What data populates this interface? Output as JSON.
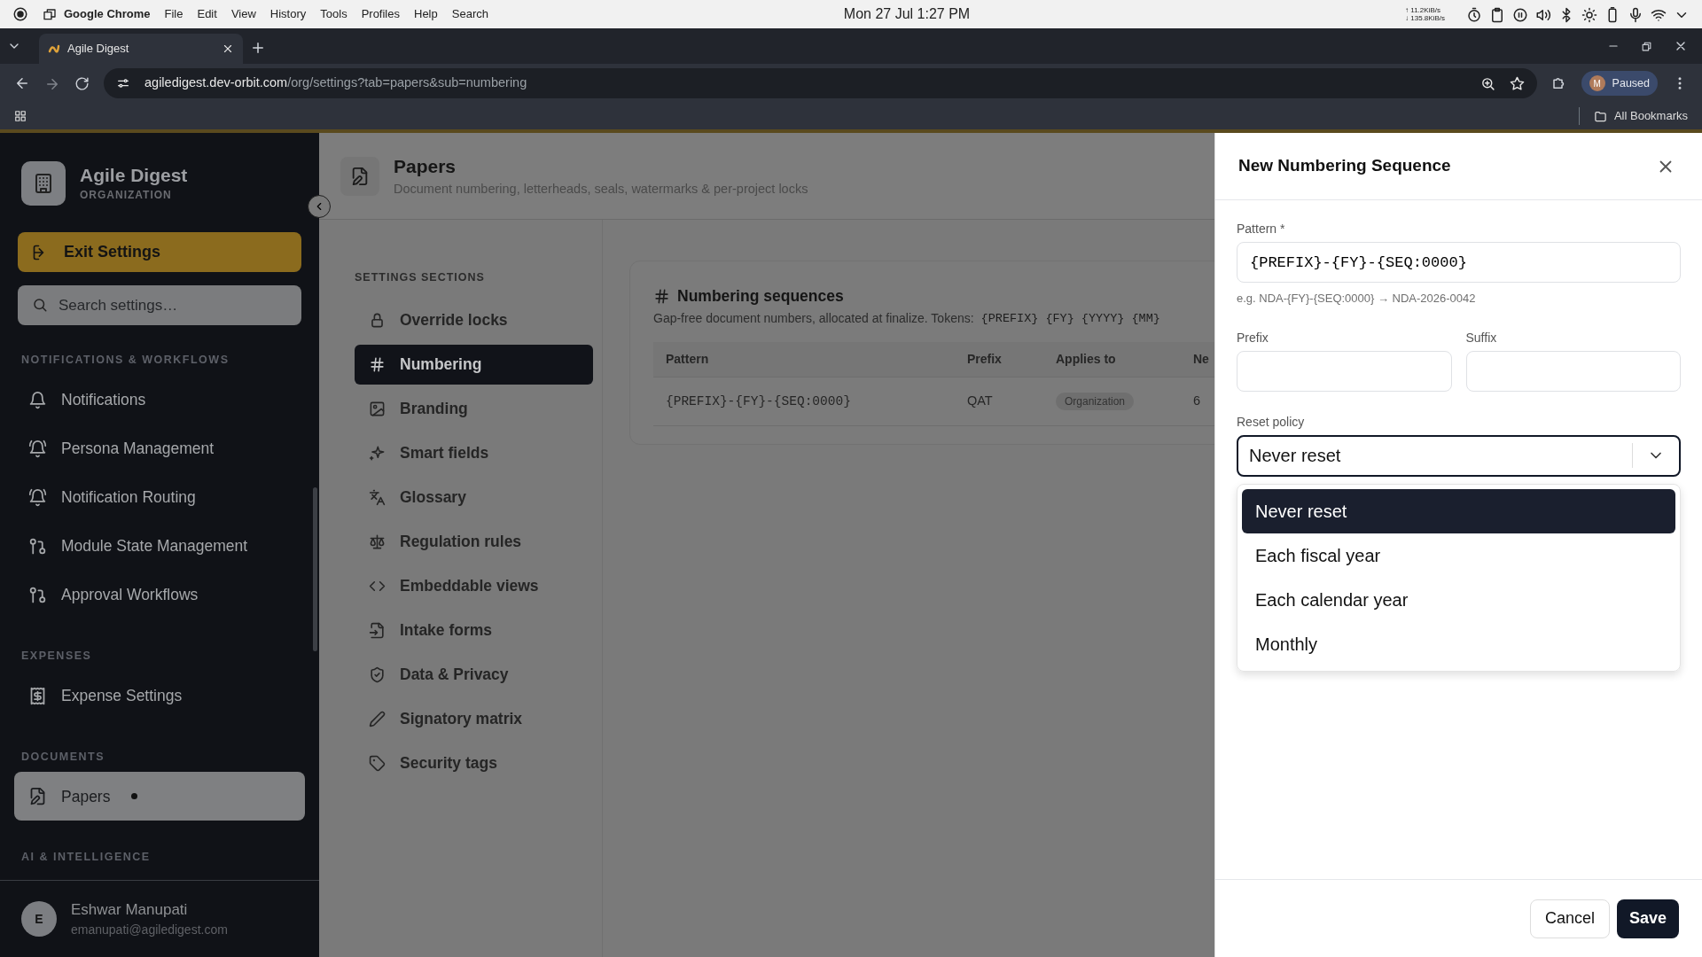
{
  "os_bar": {
    "app": "Google Chrome",
    "menus": [
      "File",
      "Edit",
      "View",
      "History",
      "Tools",
      "Profiles",
      "Help",
      "Search"
    ],
    "clock": "Mon 27 Jul  1:27 PM",
    "net_up": "↑ 11.2KiB/s",
    "net_down": "↓ 135.8KiB/s"
  },
  "browser": {
    "tab_title": "Agile Digest",
    "url_host": "agiledigest.dev-orbit.com",
    "url_path": "/org/settings?tab=papers&sub=numbering",
    "profile_initial": "M",
    "profile_label": "Paused",
    "bookmarks": "All Bookmarks"
  },
  "sidebar": {
    "org_name": "Agile Digest",
    "org_type": "ORGANIZATION",
    "exit_label": "Exit Settings",
    "search_placeholder": "Search settings…",
    "groups": [
      {
        "title": "NOTIFICATIONS & WORKFLOWS",
        "items": [
          {
            "label": "Notifications",
            "selected": false,
            "dot": false
          },
          {
            "label": "Persona Management",
            "selected": false,
            "dot": false
          },
          {
            "label": "Notification Routing",
            "selected": false,
            "dot": false
          },
          {
            "label": "Module State Management",
            "selected": false,
            "dot": false
          },
          {
            "label": "Approval Workflows",
            "selected": false,
            "dot": false
          }
        ]
      },
      {
        "title": "EXPENSES",
        "items": [
          {
            "label": "Expense Settings",
            "selected": false,
            "dot": false
          }
        ]
      },
      {
        "title": "DOCUMENTS",
        "items": [
          {
            "label": "Papers",
            "selected": true,
            "dot": true
          }
        ]
      },
      {
        "title": "AI & INTELLIGENCE"
      }
    ],
    "user": {
      "initial": "E",
      "name": "Eshwar Manupati",
      "email": "emanupati@agiledigest.com"
    }
  },
  "page": {
    "title": "Papers",
    "subtitle": "Document numbering, letterheads, seals, watermarks & per-project locks"
  },
  "sections": {
    "title": "SETTINGS SECTIONS",
    "items": [
      {
        "label": "Override locks",
        "selected": false
      },
      {
        "label": "Numbering",
        "selected": true
      },
      {
        "label": "Branding",
        "selected": false
      },
      {
        "label": "Smart fields",
        "selected": false
      },
      {
        "label": "Glossary",
        "selected": false
      },
      {
        "label": "Regulation rules",
        "selected": false
      },
      {
        "label": "Embeddable views",
        "selected": false
      },
      {
        "label": "Intake forms",
        "selected": false
      },
      {
        "label": "Data & Privacy",
        "selected": false
      },
      {
        "label": "Signatory matrix",
        "selected": false
      },
      {
        "label": "Security tags",
        "selected": false
      }
    ]
  },
  "card": {
    "title": "Numbering sequences",
    "description": "Gap-free document numbers, allocated at finalize. Tokens:",
    "tokens": [
      "{PREFIX}",
      "{FY}",
      "{YYYY}",
      "{MM}"
    ],
    "table": {
      "columns": [
        "Pattern",
        "Prefix",
        "Applies to",
        "Ne"
      ],
      "rows": [
        {
          "cells": [
            "{PREFIX}-{FY}-{SEQ:0000}",
            "QAT",
            "Organization",
            "6"
          ]
        }
      ]
    }
  },
  "drawer": {
    "title": "New Numbering Sequence",
    "pattern": {
      "label": "Pattern *",
      "value": "{PREFIX}-{FY}-{SEQ:0000}",
      "hint": "e.g. NDA-{FY}-{SEQ:0000} → NDA-2026-0042"
    },
    "prefix": {
      "label": "Prefix"
    },
    "suffix": {
      "label": "Suffix"
    },
    "reset_policy": {
      "label": "Reset policy",
      "value": "Never reset",
      "expanded": true,
      "options": [
        {
          "label": "Never reset",
          "selected": true
        },
        {
          "label": "Each fiscal year",
          "selected": false
        },
        {
          "label": "Each calendar year",
          "selected": false
        },
        {
          "label": "Monthly",
          "selected": false
        }
      ]
    },
    "buttons": [
      {
        "label": "Cancel",
        "kind": "secondary"
      },
      {
        "label": "Save",
        "kind": "primary"
      }
    ]
  }
}
